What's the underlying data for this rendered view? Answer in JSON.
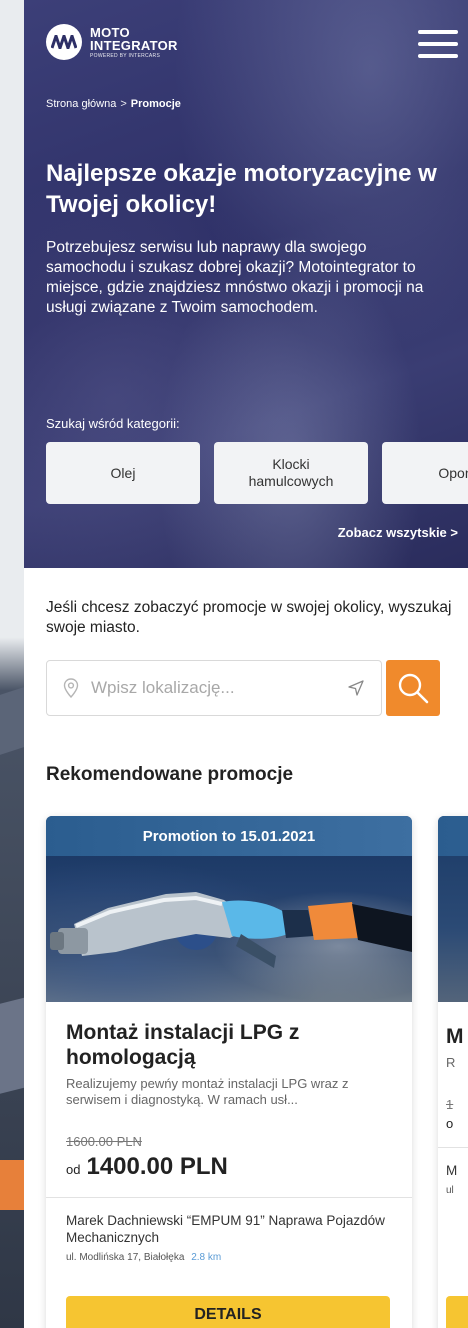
{
  "header": {
    "logo_line1": "MOTO",
    "logo_line2": "INTEGRATOR",
    "logo_tagline": "POWERED BY INTERCARS",
    "menu_icon": "hamburger-icon"
  },
  "breadcrumb": {
    "home": "Strona główna",
    "separator": ">",
    "current": "Promocje"
  },
  "hero": {
    "title": "Najlepsze okazje motoryzacyjne w Twojej okolicy!",
    "description": "Potrzebujesz serwisu lub naprawy dla swojego samochodu i szukasz dobrej okazji? Motointegrator to miejsce, gdzie znajdziesz mnóstwo okazji i promocji na usługi związane z Twoim samochodem.",
    "categories_label": "Szukaj wśród kategorii:",
    "categories": [
      {
        "label": "Olej"
      },
      {
        "label": "Klocki hamulcowych"
      },
      {
        "label": "Opony"
      }
    ],
    "see_all": "Zobacz wszytskie >"
  },
  "search": {
    "intro": "Jeśli chcesz zobaczyć promocje w swojej okolicy, wyszukaj swoje miasto.",
    "placeholder": "Wpisz lokalizację...",
    "value": "",
    "pin_icon": "location-pin-icon",
    "locate_icon": "navigation-arrow-icon",
    "button_icon": "search-icon"
  },
  "recommended": {
    "title": "Rekomendowane promocje",
    "cards": [
      {
        "banner": "Promotion to 15.01.2021",
        "title": "Montaż instalacji LPG z homologacją",
        "description": "Realizujemy pewńy montaż instalacji LPG wraz z serwisem i diagnostyką. W ramach usł...",
        "price_old": "1600.00 PLN",
        "price_prefix": "od",
        "price_new": "1400.00 PLN",
        "merchant": "Marek Dachniewski “EMPUM 91” Naprawa Pojazdów Mechanicznych",
        "address": "ul. Modlińska 17, Białołęka",
        "distance": "2.8 km",
        "button": "DETAILS"
      },
      {
        "title": "M h",
        "description": "R w",
        "price_old": "1",
        "price_prefix": "o",
        "merchant": "M P",
        "address": "ul"
      }
    ]
  },
  "colors": {
    "accent_orange": "#f08a2c",
    "details_yellow": "#f6c531",
    "banner_blue": "#2b5d8f",
    "hero_purple": "#2d2f66",
    "distance_blue": "#5a9bd5"
  }
}
